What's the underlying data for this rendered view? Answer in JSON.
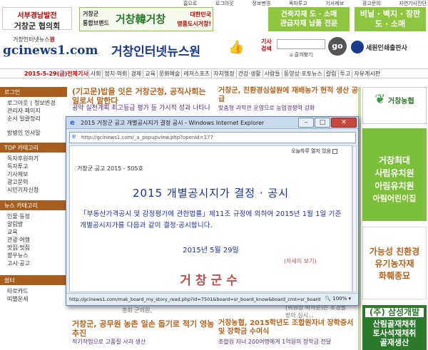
{
  "top_links": [
    "홈으로",
    "로그아웃",
    "정보변경",
    "독자투고",
    "기사제보",
    "광고문의",
    "자연기사진단"
  ],
  "banners": {
    "seobu": {
      "line1": "서부경남발전",
      "line2": "거창군 협의회"
    },
    "brand": {
      "left1": "거창군",
      "left2": "통합브랜드",
      "logo": "거창韓거창",
      "right1": "대한민국",
      "right2": "명품도시거창!"
    },
    "construct": {
      "line1": "건축자재 도 · 소매",
      "line2": "관급자재 납품 전문"
    },
    "vinyl": {
      "line1": "비닐 · 벽지 · 장판",
      "line2": "도 · 소매"
    }
  },
  "logo": {
    "small": "거창인터넷뉴스",
    "small_red": "원",
    "big": "gcinews1.com"
  },
  "site_title": "거창인터넷뉴스원",
  "search": {
    "label": "기사 검색",
    "placeholder": "",
    "button": "go",
    "favorite": "즐겨찾기"
  },
  "print_logo": "세원인쇄출판사",
  "nav": {
    "date": "2015-5-29(금)",
    "highlight": "전체기사",
    "items": [
      "사회",
      "정치·의회",
      "경제",
      "교육",
      "문화예술",
      "레저스포츠",
      "자치행정",
      "건강·생활",
      "사람들",
      "동영상·포토뉴스",
      "칼럼",
      "투고",
      "자유게시판"
    ]
  },
  "sidebar": {
    "login_head": "로그인",
    "login_items": [
      "로그아웃",
      "정보변경",
      "관리자 페이지",
      "순서 일괄정리"
    ],
    "greeting": "방병인 인사말",
    "top_head": "TOP 카테고리",
    "top_items": [
      "독자후원하기",
      "독자투고",
      "기사제보",
      "광고문의",
      "시민기자신청"
    ],
    "news_head": "뉴스 카테고리",
    "news_items": [
      "인물·동정",
      "알림방",
      "교육",
      "관광·여행",
      "맛집·멋집",
      "향우뉴스",
      "고시·공고"
    ],
    "shop_head": "쉼터",
    "shop_items": [
      "타로카드",
      "띠별운세"
    ]
  },
  "center": {
    "headline1": "(기고문)밥을 잇은 거창군청, 공직사회는 일로서 말한다",
    "sub1": "공약 실천계획 최고등급 평가 등 가시적 성과 나타나",
    "headline2": "거창군, 친환경심설원에 재배농가 현적 생산 공급",
    "sub2": "맞춤형 과학관 운영으로 농업경쟁력 강화",
    "bottom1": "거창군, 공무원 농촌 일손 돕기로 적기 영농 추진",
    "sub3": "적기작업으로 고품질 사과 생산",
    "bottom2": "거창농협, 2015학년도 조합원자녀 장학증서 및 장학금 수여식",
    "sub4": "조합원 자녀 200여명에게 1억원의 장학금 전달",
    "faded_a": "총회 군의원,",
    "faded_b1": "(위원장 박하준)는 조경들",
    "faded_b2": "받아 실시..."
  },
  "right_ads": {
    "farm": "거창농협",
    "kinder": {
      "l1": "거창최대",
      "l2": "사립유치원",
      "l3": "아림유치원",
      "l4": "아림어린이집"
    },
    "eco": {
      "l1": "가능성 친환경",
      "l2": "유기농자재",
      "l3": "화훼종묘"
    },
    "samsung": {
      "l1": "(주) 삼성개발",
      "l2": "산림골재채취",
      "l3": "토사석재채취",
      "l4": "골재생산"
    }
  },
  "popup": {
    "title": "2015 거창군 공고 개별공시지가 결정 공시 - Windows Internet Explorer",
    "url": "http://gcinews1.com/_a_popupview.php?openid=177",
    "close_today": "오늘하루 열지 않음",
    "notice_no": "거창군 공고 2015 - 505호",
    "notice_title": "2015 개별공시지가 결정 · 공시",
    "notice_body": "「부동산가격공시 및 감정평가에 관한법률」제11조 규정에 의하여 2015년 1월 1일 기준 개별공시지가를 다음과 같이 결정·공시합니다.",
    "notice_date": "2015년 5월 29일",
    "notice_more": "(자세이 보기)",
    "notice_sign": "거창군수",
    "status_url": "http://gcinews1.com/mak_board_my_story_read.php?id=7501&board=sr_board_know&board_cmt=sr_board",
    "zoom": "100%"
  }
}
